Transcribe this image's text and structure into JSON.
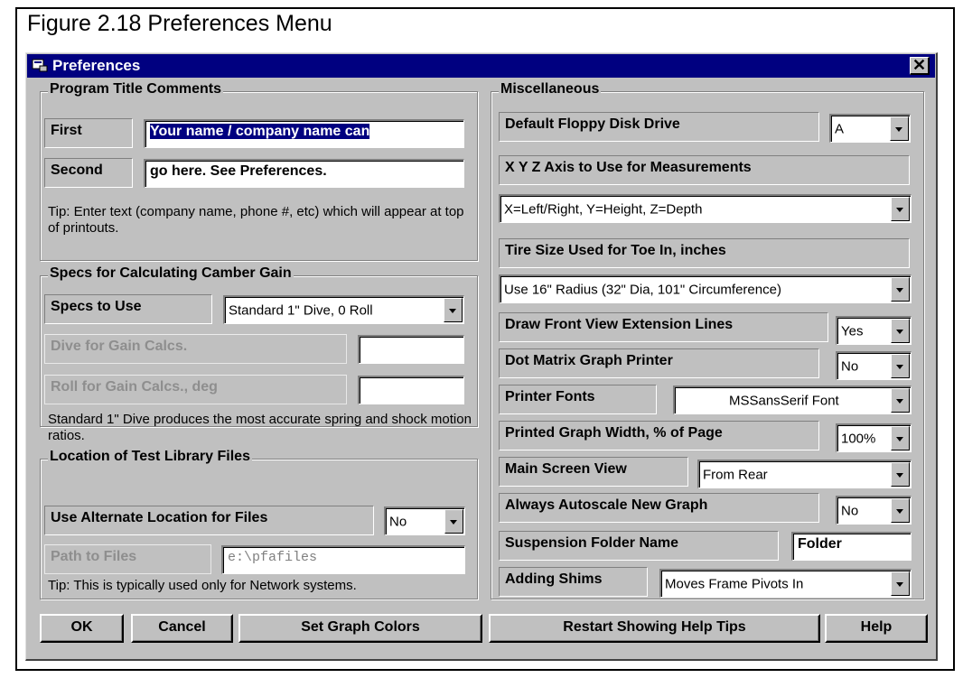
{
  "figure_caption": "Figure 2.18   Preferences Menu",
  "window": {
    "title": "Preferences",
    "close_label": "✕"
  },
  "program_title": {
    "heading": "Program Title Comments",
    "first_label": "First",
    "first_value": "Your name / company name can",
    "second_label": "Second",
    "second_value": "go here.  See Preferences.",
    "tip": "Tip:  Enter text (company name, phone #, etc) which will appear at top of printouts."
  },
  "camber": {
    "heading": "Specs for Calculating Camber Gain",
    "specs_label": "Specs to Use",
    "specs_value": "Standard 1\" Dive, 0 Roll",
    "dive_label": "Dive for Gain Calcs.",
    "dive_value": "",
    "roll_label": "Roll for Gain Calcs., deg",
    "roll_value": "",
    "note": "Standard 1\" Dive produces the most accurate spring and shock motion ratios."
  },
  "library": {
    "heading": "Location of Test Library Files",
    "alt_label": "Use Alternate Location for Files",
    "alt_value": "No",
    "path_label": "Path to Files",
    "path_value": "e:\\pfafiles",
    "tip": "Tip:  This is typically used only for Network systems."
  },
  "misc": {
    "heading": "Miscellaneous",
    "floppy_label": "Default Floppy Disk Drive",
    "floppy_value": "A",
    "xyz_label": "X Y Z Axis to Use for Measurements",
    "xyz_value": "X=Left/Right, Y=Height, Z=Depth",
    "tire_label": "Tire Size Used for Toe In, inches",
    "tire_value": "Use 16\" Radius (32\" Dia, 101\" Circumference)",
    "ext_label": "Draw Front View Extension Lines",
    "ext_value": "Yes",
    "dot_label": "Dot Matrix Graph Printer",
    "dot_value": "No",
    "fonts_label": "Printer Fonts",
    "fonts_value": "MSSansSerif Font",
    "width_label": "Printed Graph Width, % of Page",
    "width_value": "100%",
    "view_label": "Main Screen View",
    "view_value": "From Rear",
    "autoscale_label": "Always Autoscale New Graph",
    "autoscale_value": "No",
    "folder_label": "Suspension Folder Name",
    "folder_value": "Folder",
    "shims_label": "Adding Shims",
    "shims_value": "Moves Frame Pivots In"
  },
  "buttons": {
    "ok": "OK",
    "cancel": "Cancel",
    "graph_colors": "Set Graph Colors",
    "restart_tips": "Restart Showing Help Tips",
    "help": "Help"
  }
}
